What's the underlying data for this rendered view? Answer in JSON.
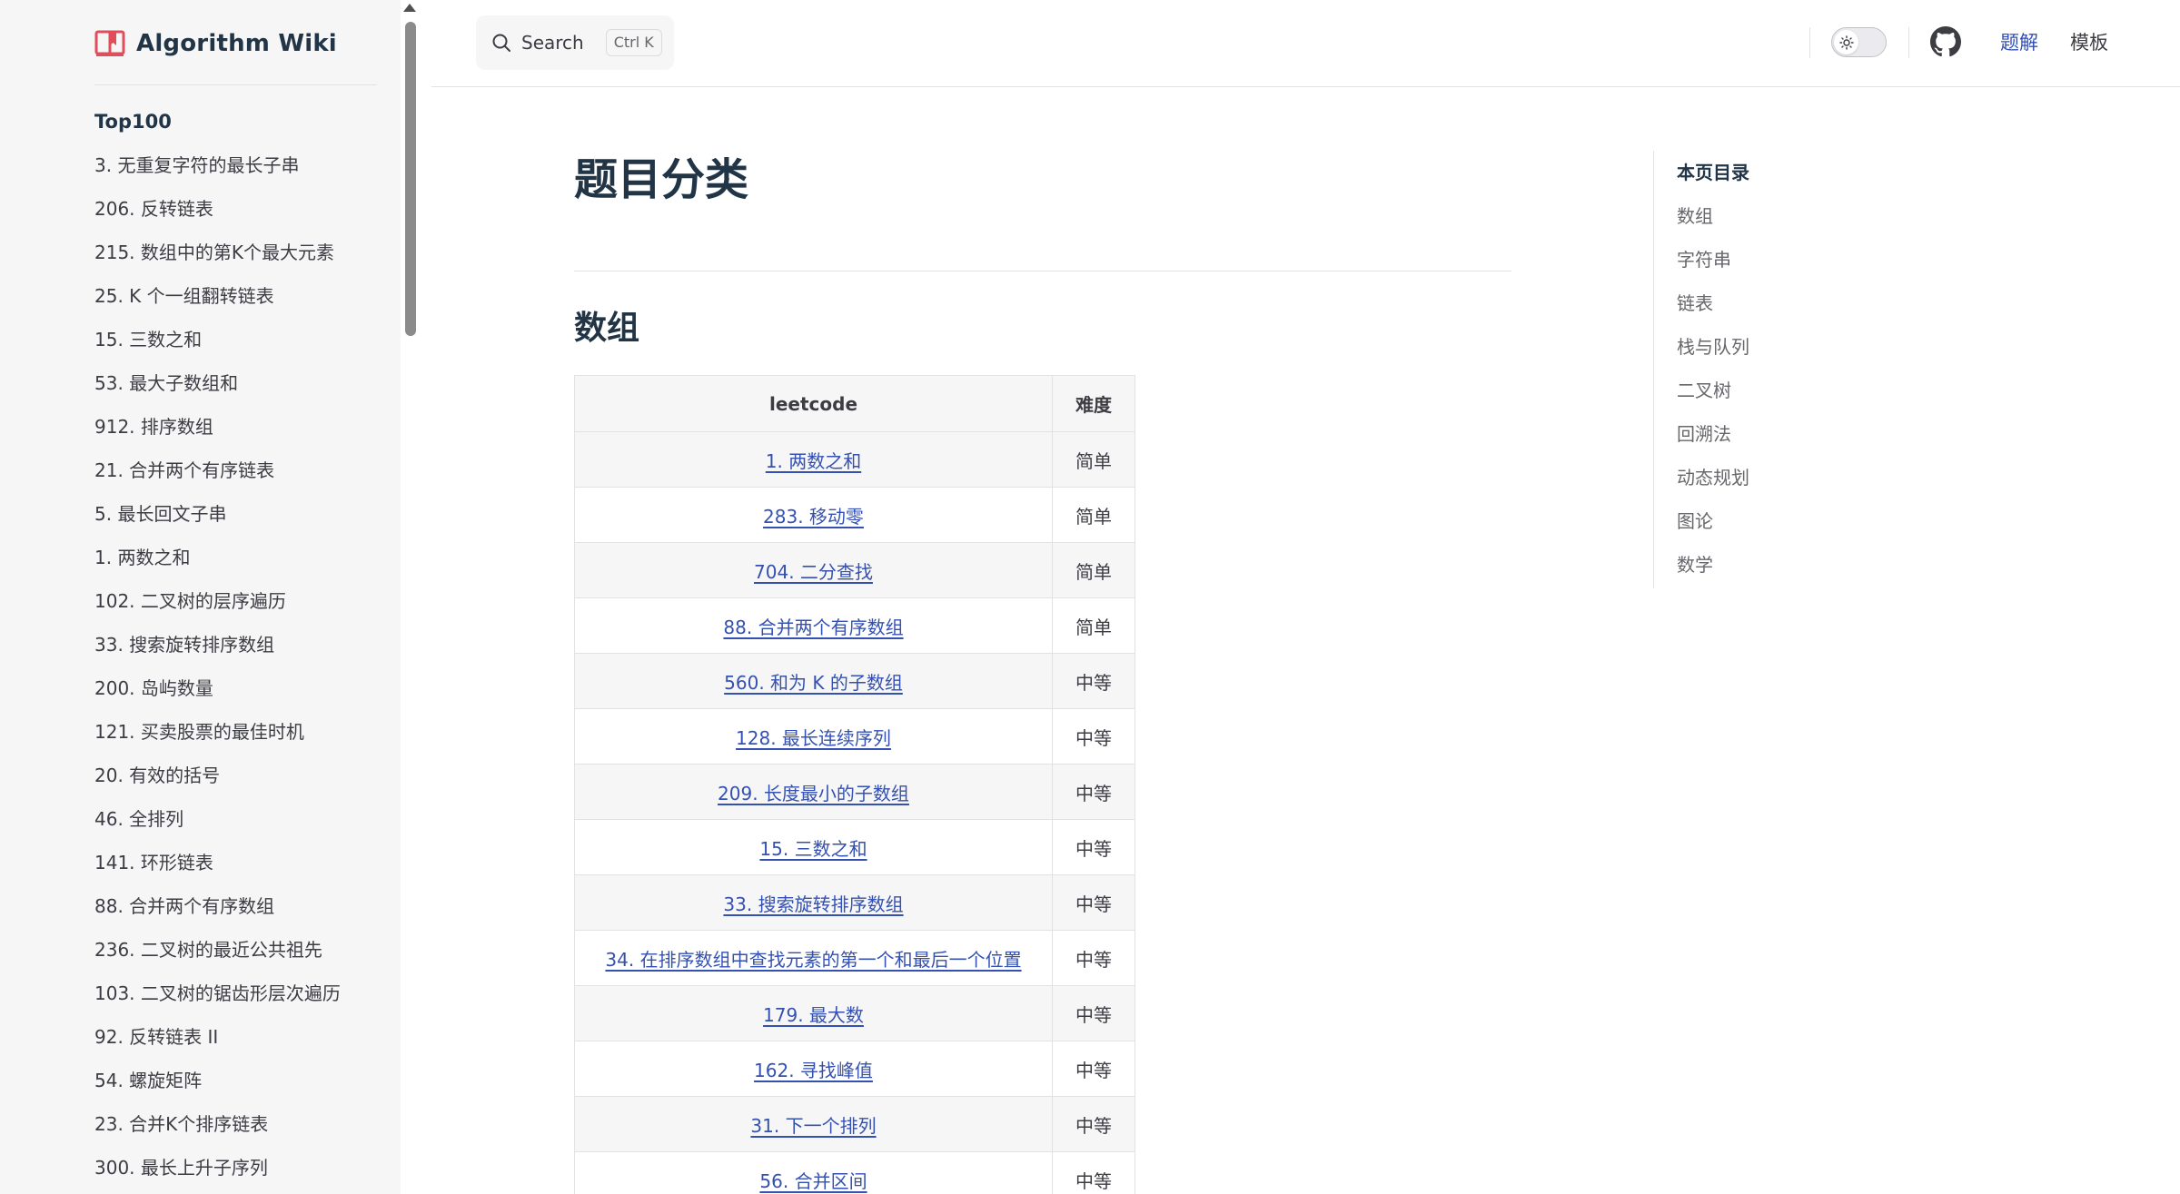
{
  "brand": {
    "title": "Algorithm Wiki",
    "icon": "book-icon",
    "accent": "#e04d5b"
  },
  "sidebar": {
    "group_title": "Top100",
    "items": [
      "3. 无重复字符的最长子串",
      "206. 反转链表",
      "215. 数组中的第K个最大元素",
      "25. K 个一组翻转链表",
      "15. 三数之和",
      "53. 最大子数组和",
      "912. 排序数组",
      "21. 合并两个有序链表",
      "5. 最长回文子串",
      "1. 两数之和",
      "102. 二叉树的层序遍历",
      "33. 搜索旋转排序数组",
      "200. 岛屿数量",
      "121. 买卖股票的最佳时机",
      "20. 有效的括号",
      "46. 全排列",
      "141. 环形链表",
      "88. 合并两个有序数组",
      "236. 二叉树的最近公共祖先",
      "103. 二叉树的锯齿形层次遍历",
      "92. 反转链表 II",
      "54. 螺旋矩阵",
      "23. 合并K个排序链表",
      "300. 最长上升子序列"
    ]
  },
  "topnav": {
    "search_label": "Search",
    "search_key": "Ctrl K",
    "links": [
      {
        "label": "题解",
        "active": true
      },
      {
        "label": "模板",
        "active": false
      }
    ],
    "link_active_color": "#3451b2"
  },
  "main": {
    "page_title": "题目分类",
    "section_title": "数组",
    "table": {
      "headers": [
        "leetcode",
        "难度"
      ],
      "rows": [
        [
          "1. 两数之和",
          "简单"
        ],
        [
          "283. 移动零",
          "简单"
        ],
        [
          "704. 二分查找",
          "简单"
        ],
        [
          "88. 合并两个有序数组",
          "简单"
        ],
        [
          "560. 和为 K 的子数组",
          "中等"
        ],
        [
          "128. 最长连续序列",
          "中等"
        ],
        [
          "209. 长度最小的子数组",
          "中等"
        ],
        [
          "15. 三数之和",
          "中等"
        ],
        [
          "33. 搜索旋转排序数组",
          "中等"
        ],
        [
          "34. 在排序数组中查找元素的第一个和最后一个位置",
          "中等"
        ],
        [
          "179. 最大数",
          "中等"
        ],
        [
          "162. 寻找峰值",
          "中等"
        ],
        [
          "31. 下一个排列",
          "中等"
        ],
        [
          "56. 合并区间",
          "中等"
        ]
      ]
    }
  },
  "outline": {
    "title": "本页目录",
    "items": [
      "数组",
      "字符串",
      "链表",
      "栈与队列",
      "二叉树",
      "回溯法",
      "动态规划",
      "图论",
      "数学"
    ]
  }
}
